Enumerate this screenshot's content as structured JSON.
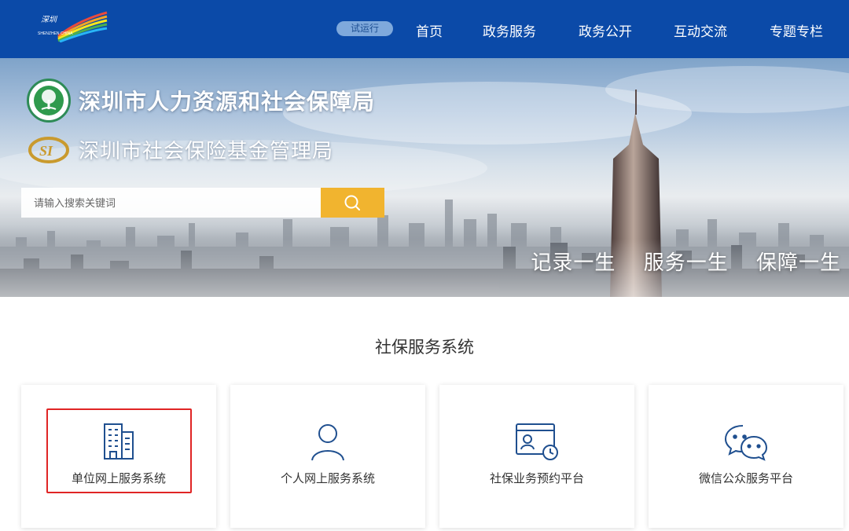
{
  "header": {
    "logo_text": "SHENZHEN CHINA",
    "trial_badge": "试运行",
    "nav": [
      {
        "label": "首页"
      },
      {
        "label": "政务服务"
      },
      {
        "label": "政务公开"
      },
      {
        "label": "互动交流"
      },
      {
        "label": "专题专栏"
      }
    ],
    "colors": {
      "bar": "#0b4aa8",
      "badge": "#7fa9dc"
    }
  },
  "hero": {
    "agency_primary": "深圳市人力资源和社会保障局",
    "agency_secondary": "深圳市社会保险基金管理局",
    "search": {
      "placeholder": "请输入搜索关键词",
      "button_icon": "search-icon"
    },
    "slogan": [
      "记录一生",
      "服务一生",
      "保障一生"
    ],
    "colors": {
      "search_button": "#f1b42f"
    }
  },
  "section": {
    "title": "社保服务系统",
    "cards": [
      {
        "label": "单位网上服务系统",
        "icon": "building-icon",
        "highlighted": true
      },
      {
        "label": "个人网上服务系统",
        "icon": "person-icon",
        "highlighted": false
      },
      {
        "label": "社保业务预约平台",
        "icon": "appointment-icon",
        "highlighted": false
      },
      {
        "label": "微信公众服务平台",
        "icon": "wechat-icon",
        "highlighted": false
      }
    ],
    "colors": {
      "icon": "#1f4f8f",
      "highlight": "#e02525"
    }
  }
}
